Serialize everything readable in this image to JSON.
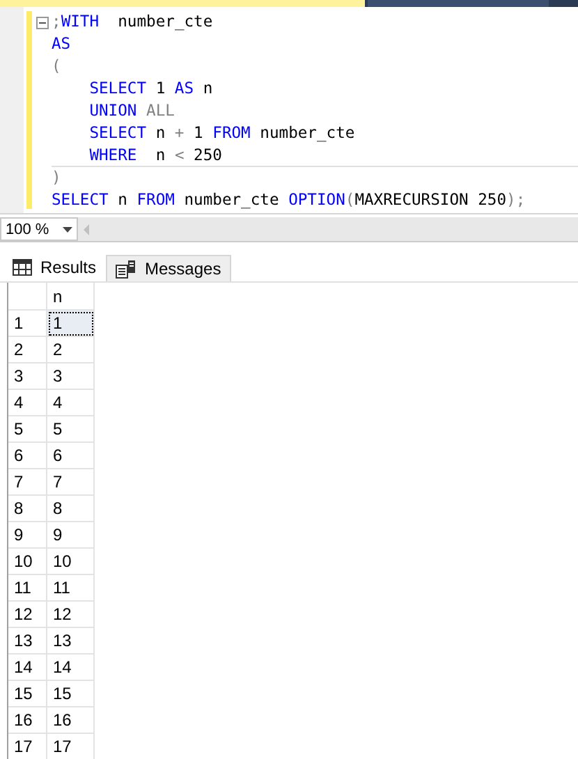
{
  "editor": {
    "lines": [
      {
        "fold_expanded": true,
        "tokens": [
          {
            "kind": "punct",
            "text": ";"
          },
          {
            "kind": "keyword",
            "text": "WITH"
          },
          {
            "kind": "plain",
            "text": "  number_cte"
          }
        ]
      },
      {
        "tokens": [
          {
            "kind": "keyword",
            "text": "AS"
          }
        ]
      },
      {
        "tokens": [
          {
            "kind": "punct",
            "text": "("
          }
        ]
      },
      {
        "indented": true,
        "tokens": [
          {
            "kind": "keyword",
            "text": "SELECT"
          },
          {
            "kind": "plain",
            "text": " 1 "
          },
          {
            "kind": "keyword",
            "text": "AS"
          },
          {
            "kind": "plain",
            "text": " n"
          }
        ]
      },
      {
        "indented": true,
        "tokens": [
          {
            "kind": "keyword",
            "text": "UNION"
          },
          {
            "kind": "punct",
            "text": " ALL"
          }
        ]
      },
      {
        "indented": true,
        "tokens": [
          {
            "kind": "keyword",
            "text": "SELECT"
          },
          {
            "kind": "plain",
            "text": " n "
          },
          {
            "kind": "punct",
            "text": "+"
          },
          {
            "kind": "plain",
            "text": " 1 "
          },
          {
            "kind": "keyword",
            "text": "FROM"
          },
          {
            "kind": "plain",
            "text": " number_cte"
          }
        ]
      },
      {
        "indented": true,
        "tokens": [
          {
            "kind": "keyword",
            "text": "WHERE"
          },
          {
            "kind": "plain",
            "text": "  n "
          },
          {
            "kind": "punct",
            "text": "<"
          },
          {
            "kind": "plain",
            "text": " 250"
          }
        ]
      },
      {
        "tokens": [
          {
            "kind": "punct",
            "text": ")"
          }
        ]
      },
      {
        "tokens": [
          {
            "kind": "keyword",
            "text": "SELECT"
          },
          {
            "kind": "plain",
            "text": " n "
          },
          {
            "kind": "keyword",
            "text": "FROM"
          },
          {
            "kind": "plain",
            "text": " number_cte "
          },
          {
            "kind": "keyword",
            "text": "OPTION"
          },
          {
            "kind": "punct",
            "text": "("
          },
          {
            "kind": "plain",
            "text": "MAXRECURSION 250"
          },
          {
            "kind": "punct",
            "text": ");"
          }
        ]
      }
    ]
  },
  "zoom": {
    "value": "100 %"
  },
  "tabs": [
    {
      "label": "Results",
      "selected": true,
      "kind": "grid"
    },
    {
      "label": "Messages",
      "selected": false,
      "kind": "messages"
    }
  ],
  "grid": {
    "columns": [
      "n"
    ],
    "rows": [
      {
        "number": "1",
        "n": "1",
        "selected": true
      },
      {
        "number": "2",
        "n": "2",
        "selected": false
      },
      {
        "number": "3",
        "n": "3",
        "selected": false
      },
      {
        "number": "4",
        "n": "4",
        "selected": false
      },
      {
        "number": "5",
        "n": "5",
        "selected": false
      },
      {
        "number": "6",
        "n": "6",
        "selected": false
      },
      {
        "number": "7",
        "n": "7",
        "selected": false
      },
      {
        "number": "8",
        "n": "8",
        "selected": false
      },
      {
        "number": "9",
        "n": "9",
        "selected": false
      },
      {
        "number": "10",
        "n": "10",
        "selected": false
      },
      {
        "number": "11",
        "n": "11",
        "selected": false
      },
      {
        "number": "12",
        "n": "12",
        "selected": false
      },
      {
        "number": "13",
        "n": "13",
        "selected": false
      },
      {
        "number": "14",
        "n": "14",
        "selected": false
      },
      {
        "number": "15",
        "n": "15",
        "selected": false
      },
      {
        "number": "16",
        "n": "16",
        "selected": false
      },
      {
        "number": "17",
        "n": "17",
        "selected": false
      }
    ]
  }
}
